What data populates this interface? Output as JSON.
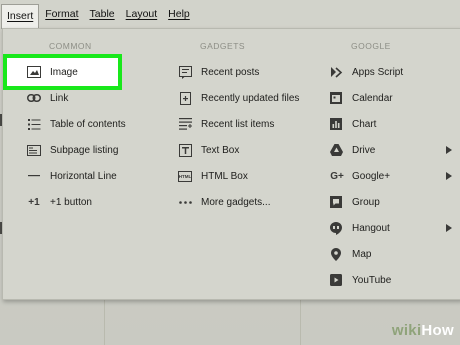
{
  "menubar": {
    "items": [
      "Insert",
      "Format",
      "Table",
      "Layout",
      "Help"
    ]
  },
  "columns": {
    "common": {
      "heading": "COMMON",
      "items": [
        {
          "label": "Image",
          "icon": "image-icon"
        },
        {
          "label": "Link",
          "icon": "link-icon"
        },
        {
          "label": "Table of contents",
          "icon": "list-icon"
        },
        {
          "label": "Subpage listing",
          "icon": "subpage-icon"
        },
        {
          "label": "Horizontal Line",
          "icon": "horizontal-line-icon"
        },
        {
          "label": "+1 button",
          "icon": "plus-one-icon"
        }
      ]
    },
    "gadgets": {
      "heading": "GADGETS",
      "items": [
        {
          "label": "Recent posts",
          "icon": "recent-posts-icon"
        },
        {
          "label": "Recently updated files",
          "icon": "recent-files-icon"
        },
        {
          "label": "Recent list items",
          "icon": "recent-list-icon"
        },
        {
          "label": "Text Box",
          "icon": "text-box-icon"
        },
        {
          "label": "HTML Box",
          "icon": "html-box-icon"
        },
        {
          "label": "More gadgets...",
          "icon": "more-icon"
        }
      ]
    },
    "google": {
      "heading": "GOOGLE",
      "items": [
        {
          "label": "Apps Script",
          "icon": "apps-script-icon"
        },
        {
          "label": "Calendar",
          "icon": "calendar-icon"
        },
        {
          "label": "Chart",
          "icon": "chart-icon"
        },
        {
          "label": "Drive",
          "icon": "drive-icon",
          "submenu": true
        },
        {
          "label": "Google+",
          "icon": "google-plus-icon",
          "submenu": true
        },
        {
          "label": "Group",
          "icon": "group-icon"
        },
        {
          "label": "Hangout",
          "icon": "hangout-icon",
          "submenu": true
        },
        {
          "label": "Map",
          "icon": "map-pin-icon"
        },
        {
          "label": "YouTube",
          "icon": "youtube-icon"
        }
      ]
    }
  },
  "highlight_color": "#19e81b",
  "watermark": {
    "part1": "wiki",
    "part2": "How"
  }
}
